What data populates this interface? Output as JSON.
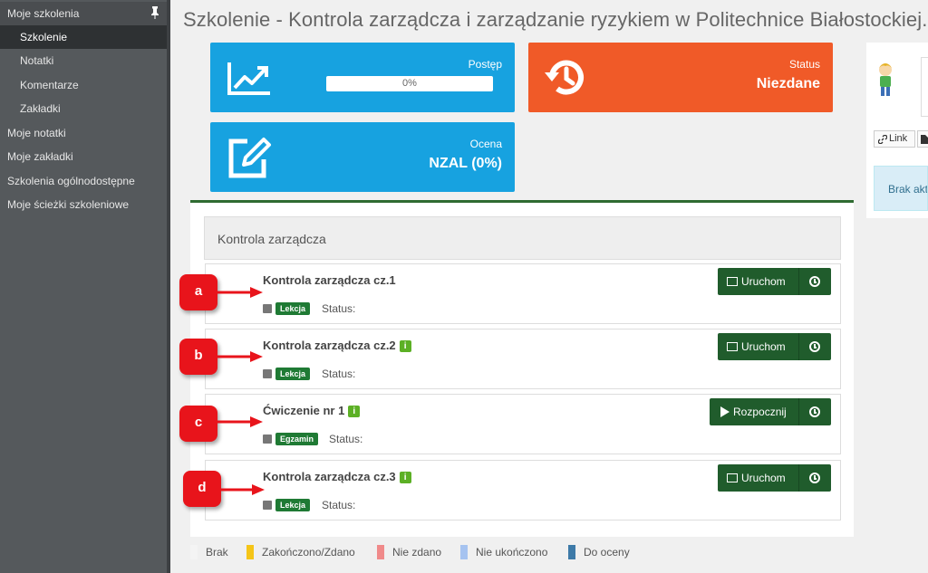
{
  "sidebar": {
    "items": [
      {
        "label": "Moje szkolenia"
      },
      {
        "label": "Szkolenie"
      },
      {
        "label": "Notatki"
      },
      {
        "label": "Komentarze"
      },
      {
        "label": "Zakładki"
      },
      {
        "label": "Moje notatki"
      },
      {
        "label": "Moje zakładki"
      },
      {
        "label": "Szkolenia ogólnodostępne"
      },
      {
        "label": "Moje ścieżki szkoleniowe"
      }
    ]
  },
  "page_title": "Szkolenie - Kontrola zarządcza i zarządzanie ryzykiem w Politechnice Białostockiej.",
  "tiles": {
    "progress": {
      "label": "Postęp",
      "value": "0%",
      "fraction": 0
    },
    "status": {
      "label": "Status",
      "value": "Niezdane"
    },
    "grade": {
      "label": "Ocena",
      "value": "NZAL (0%)"
    }
  },
  "profile": {
    "link_label": "Link",
    "alert_text": "Brak akt"
  },
  "section": {
    "title": "Kontrola zarządcza"
  },
  "status_label": "Status:",
  "lessons": [
    {
      "title": "Kontrola zarządcza cz.1",
      "info": false,
      "type": "Lekcja",
      "action": "Uruchom"
    },
    {
      "title": "Kontrola zarządcza cz.2",
      "info": true,
      "type": "Lekcja",
      "action": "Uruchom"
    },
    {
      "title": "Ćwiczenie nr 1",
      "info": true,
      "type": "Egzamin",
      "action": "Rozpocznij"
    },
    {
      "title": "Kontrola zarządcza cz.3",
      "info": true,
      "type": "Lekcja",
      "action": "Uruchom"
    }
  ],
  "markers": [
    "a",
    "b",
    "c",
    "d"
  ],
  "info_glyph": "i",
  "legend": [
    {
      "label": "Brak",
      "color": "#f4f4f4"
    },
    {
      "label": "Zakończono/Zdano",
      "color": "#f5c518"
    },
    {
      "label": "Nie zdano",
      "color": "#f08a8a"
    },
    {
      "label": "Nie ukończono",
      "color": "#a6c3f0"
    },
    {
      "label": "Do oceny",
      "color": "#3d7aa8"
    }
  ],
  "colors": {
    "tile_blue": "#17a2e0",
    "tile_orange": "#f05a28",
    "button_green": "#205c2c",
    "badge_green": "#1f7a34",
    "marker_red": "#e8141b"
  }
}
